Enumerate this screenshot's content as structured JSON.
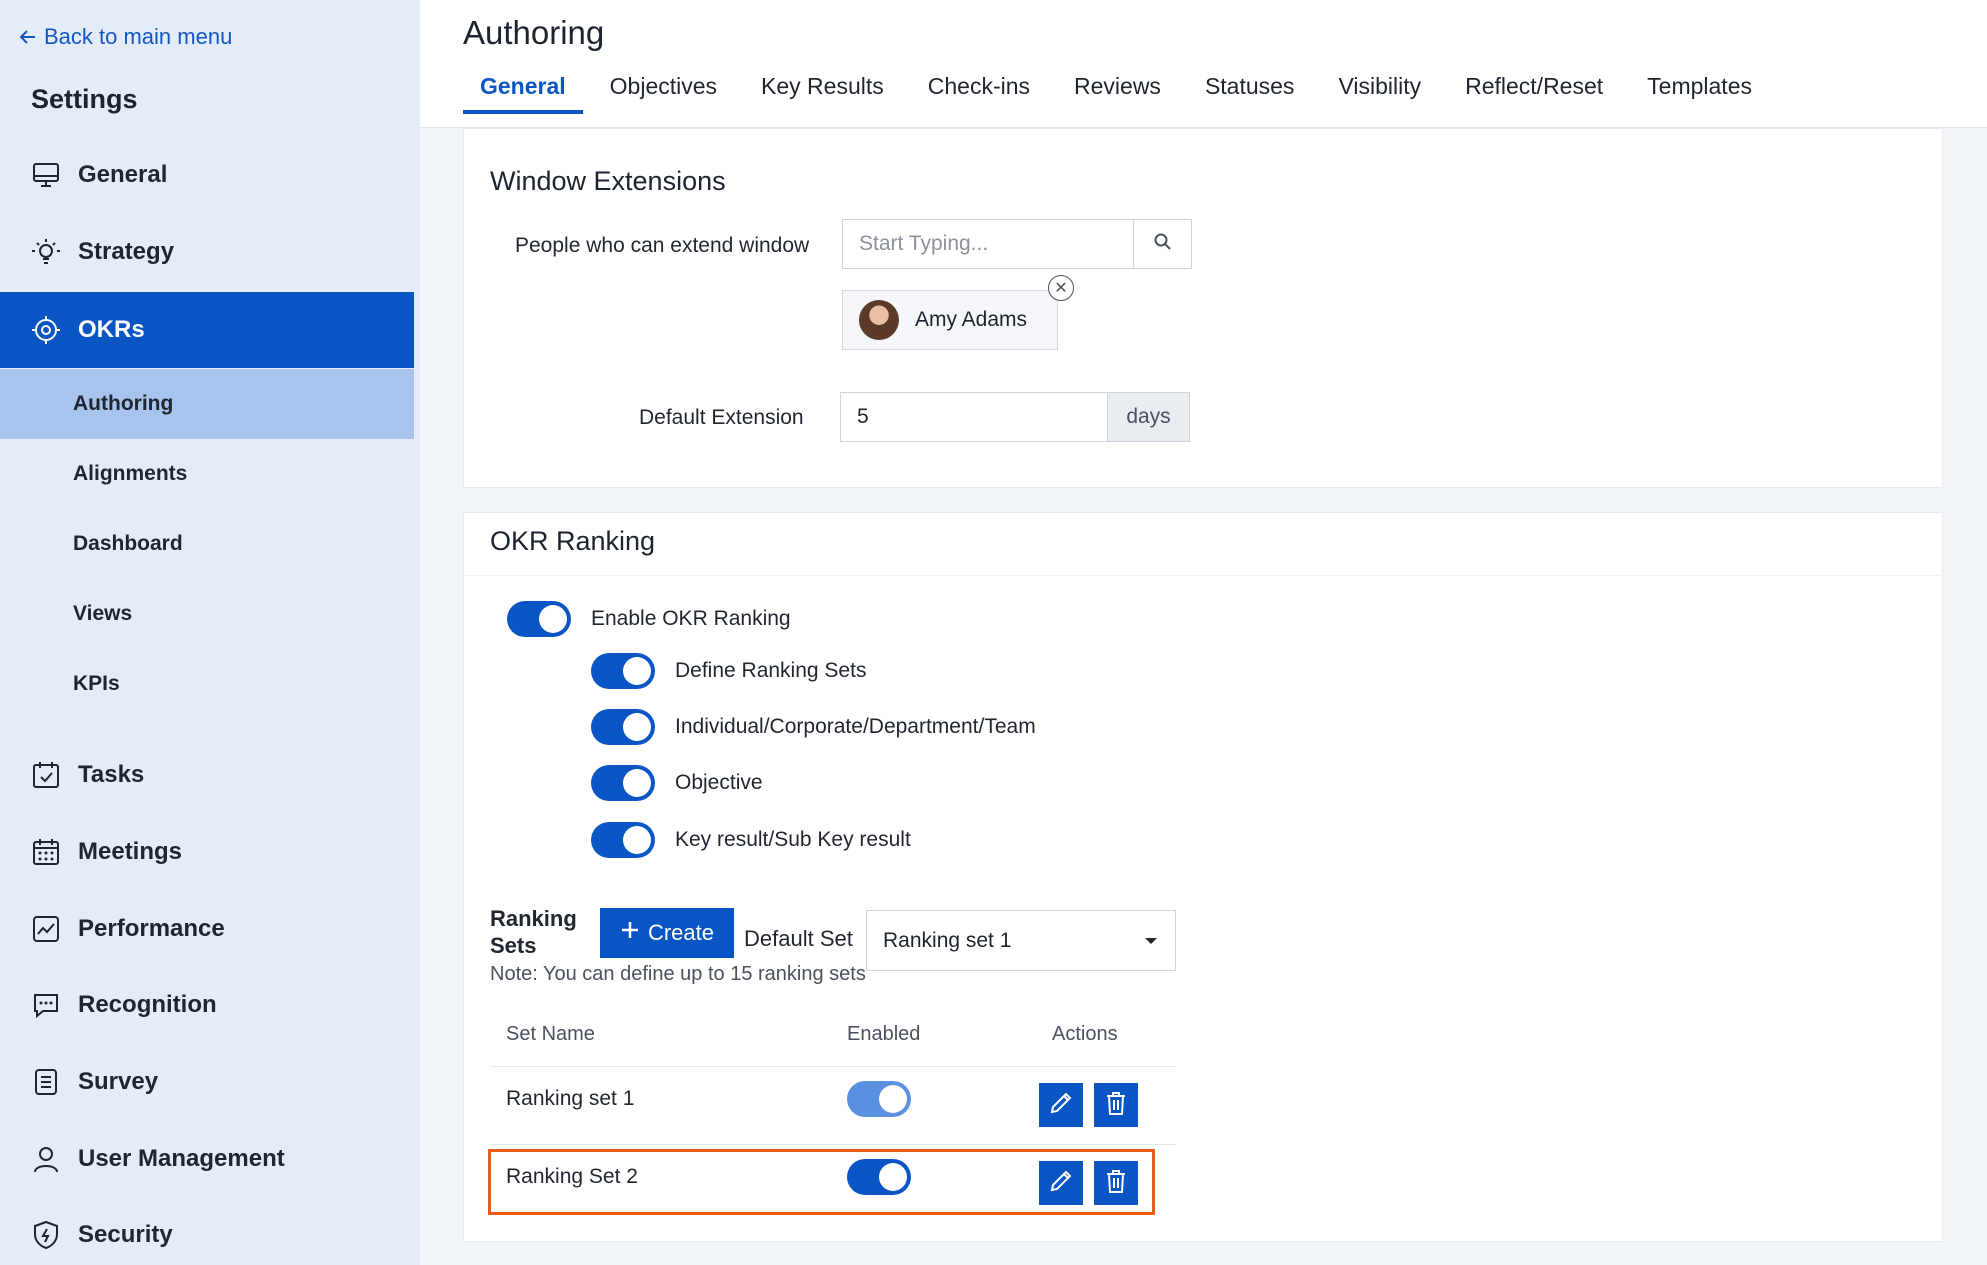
{
  "sidebar": {
    "back_label": "Back to main menu",
    "title": "Settings",
    "items": [
      {
        "label": "General",
        "icon": "monitor-icon"
      },
      {
        "label": "Strategy",
        "icon": "lightbulb-icon"
      },
      {
        "label": "OKRs",
        "icon": "target-icon"
      },
      {
        "label": "Tasks",
        "icon": "calendar-check-icon"
      },
      {
        "label": "Meetings",
        "icon": "calendar-grid-icon"
      },
      {
        "label": "Performance",
        "icon": "chart-line-icon"
      },
      {
        "label": "Recognition",
        "icon": "chat-bubble-icon"
      },
      {
        "label": "Survey",
        "icon": "list-doc-icon"
      },
      {
        "label": "User Management",
        "icon": "user-icon"
      },
      {
        "label": "Security",
        "icon": "shield-icon"
      }
    ],
    "sub_items": [
      "Authoring",
      "Alignments",
      "Dashboard",
      "Views",
      "KPIs"
    ]
  },
  "header": {
    "title": "Authoring",
    "tabs": [
      "General",
      "Objectives",
      "Key Results",
      "Check-ins",
      "Reviews",
      "Statuses",
      "Visibility",
      "Reflect/Reset",
      "Templates"
    ]
  },
  "window_extensions": {
    "title": "Window Extensions",
    "people_label": "People who can extend window",
    "search_placeholder": "Start Typing...",
    "chip_name": "Amy Adams",
    "default_extension_label": "Default Extension",
    "default_extension_value": "5",
    "default_extension_unit": "days"
  },
  "okr_ranking": {
    "title": "OKR Ranking",
    "enable_label": "Enable OKR Ranking",
    "toggles": [
      "Define Ranking Sets",
      "Individual/Corporate/Department/Team",
      "Objective",
      "Key result/Sub Key result"
    ],
    "ranking_sets_label_1": "Ranking",
    "ranking_sets_label_2": "Sets",
    "create_label": "Create",
    "default_set_label": "Default Set",
    "default_set_value": "Ranking set 1",
    "note": "Note: You can define up to 15 ranking sets",
    "table": {
      "headers": [
        "Set Name",
        "Enabled",
        "Actions"
      ],
      "rows": [
        {
          "name": "Ranking set 1",
          "enabled": true
        },
        {
          "name": "Ranking Set 2",
          "enabled": true
        }
      ]
    }
  },
  "colors": {
    "accent": "#0a55c4",
    "highlight": "#ea5a1b",
    "sidebar_bg": "#e4ecf9"
  }
}
